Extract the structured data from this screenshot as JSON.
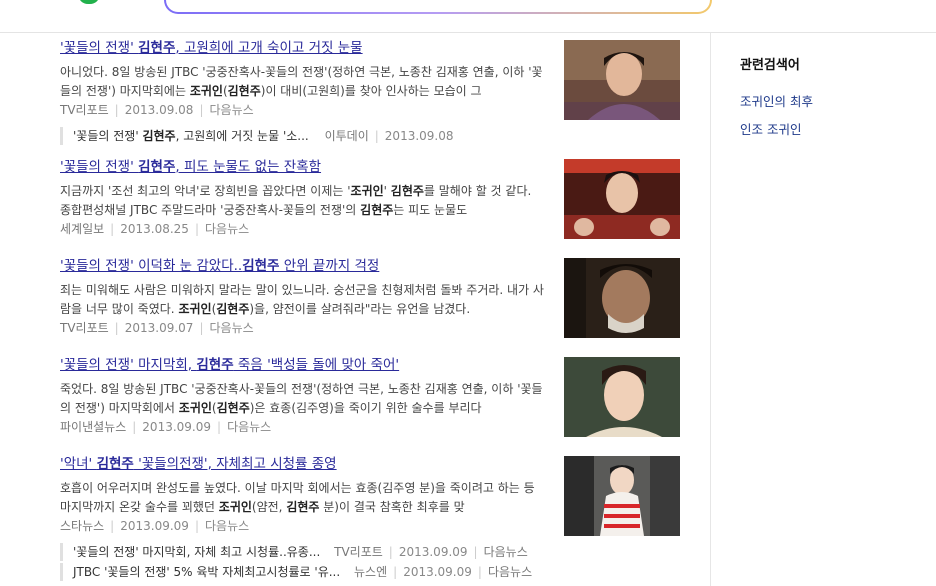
{
  "results": [
    {
      "title_pre": "'꽃들의 전쟁' ",
      "title_bold": "김현주",
      "title_post": ", 고원희에 고개 숙이고 거짓 눈물",
      "desc_html": "아니었다. 8일 방송된 JTBC '궁중잔혹사-꽃들의 전쟁'(정하연 극본, 노종찬 김재홍 연출, 이하 '꽃들의 전쟁') 마지막회에는 <b>조귀인</b>(<b>김현주</b>)이 대비(고원희)를 찾아 인사하는 모습이 그",
      "source": "TV리포트",
      "date": "2013.09.08",
      "more": "다음뉴스"
    },
    {
      "title_pre": "'꽃들의 전쟁' ",
      "title_bold": "김현주",
      "title_post": ", 피도 눈물도 없는 잔혹함",
      "desc_html": "지금까지 '조선 최고의 악녀'로 장희빈을 꼽았다면 이제는 '<b>조귀인</b>' <b>김현주</b>를 말해야 할 것 같다. 종합편성채널 JTBC 주말드라마 '궁중잔혹사-꽃들의 전쟁'의 <b>김현주</b>는 피도 눈물도",
      "source": "세계일보",
      "date": "2013.08.25",
      "more": "다음뉴스"
    },
    {
      "title_pre": "'꽃들의 전쟁' 이덕화 눈 감았다..",
      "title_bold": "김현주",
      "title_post": " 안위 끝까지 걱정",
      "desc_html": "죄는 미워해도 사람은 미워하지 말라는 말이 있느니라. 숭선군을 친형제처럼 돌봐 주거라. 내가 사람을 너무 많이 죽였다. <b>조귀인</b>(<b>김현주</b>)을, 얌전이를 살려줘라\"라는 유언을 남겼다.",
      "source": "TV리포트",
      "date": "2013.09.07",
      "more": "다음뉴스"
    },
    {
      "title_pre": "'꽃들의 전쟁' 마지막회, ",
      "title_bold": "김현주",
      "title_post": " 죽음 '백성들 돌에 맞아 죽어'",
      "desc_html": "죽었다. 8일 방송된 JTBC '궁중잔혹사-꽃들의 전쟁'(정하연 극본, 노종찬 김재홍 연출, 이하 '꽃들의 전쟁') 마지막회에서 <b>조귀인</b>(<b>김현주</b>)은 효종(김주영)을 죽이기 위한 술수를 부리다",
      "source": "파이낸셜뉴스",
      "date": "2013.09.09",
      "more": "다음뉴스"
    },
    {
      "title_pre": "'악녀' ",
      "title_bold": "김현주",
      "title_post": " '꽃들의전쟁', 자체최고 시청률 종영",
      "desc_html": "호흡이 어우러지며 완성도를 높였다. 이날 마지막 회에서는 효종(김주영 분)을 죽이려고 하는 등 마지막까지 온갖 술수를 꾀했던 <b>조귀인</b>(얌전, <b>김현주</b> 분)이 결국 참혹한 최후를 맞",
      "source": "스타뉴스",
      "date": "2013.09.09",
      "more": "다음뉴스"
    }
  ],
  "related_1": {
    "title_pre": "'꽃들의 전쟁' ",
    "title_bold": "김현주",
    "title_post": ", 고원희에 거짓 눈물 '소...",
    "source": "이투데이",
    "date": "2013.09.08"
  },
  "related_5a": {
    "title": "'꽃들의 전쟁' 마지막회, 자체 최고 시청률..유종...",
    "source": "TV리포트",
    "date": "2013.09.09",
    "more": "다음뉴스"
  },
  "related_5b": {
    "title": "JTBC '꽃들의 전쟁' 5% 육박 자체최고시청률로 '유...",
    "source": "뉴스엔",
    "date": "2013.09.09",
    "more": "다음뉴스"
  },
  "sidebar": {
    "heading": "관련검색어",
    "links": [
      "조귀인의 최후",
      "인조 조귀인"
    ]
  }
}
